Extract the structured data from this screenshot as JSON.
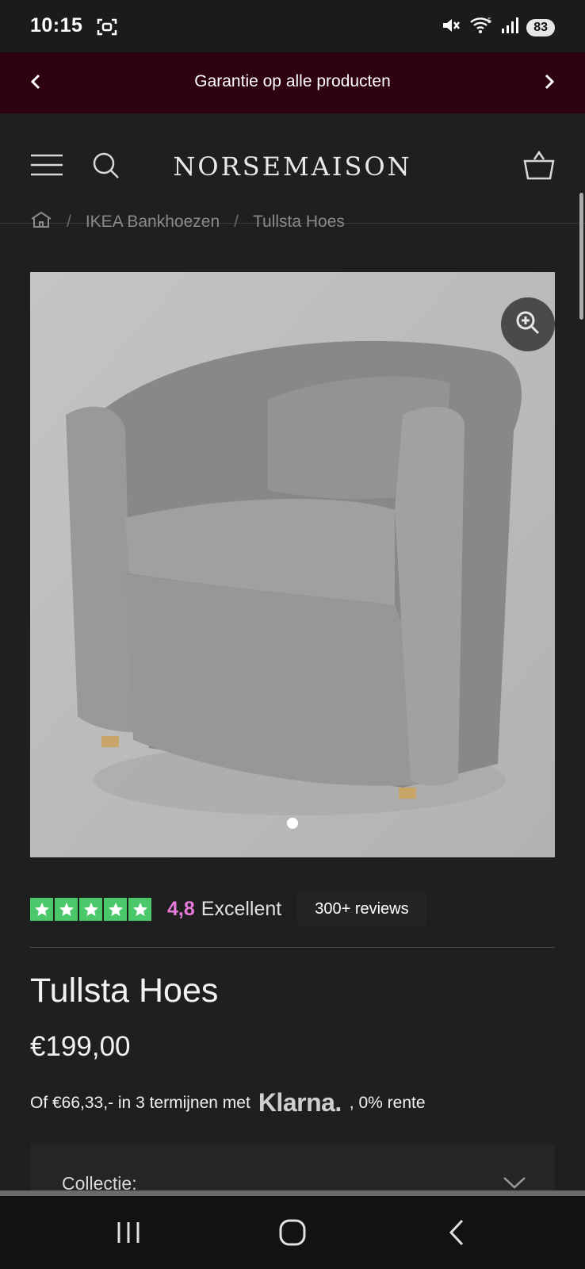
{
  "status_bar": {
    "time": "10:15",
    "battery": "83"
  },
  "announcement": {
    "text": "Garantie op alle producten"
  },
  "header": {
    "logo": "NORSEMAISON"
  },
  "breadcrumb": {
    "items": [
      "IKEA Bankhoezen",
      "Tullsta Hoes"
    ]
  },
  "rating": {
    "score": "4,8",
    "label": "Excellent",
    "reviews": "300+ reviews",
    "stars": 5,
    "star_color": "#4bc96a"
  },
  "product": {
    "title": "Tullsta Hoes",
    "price": "€199,00",
    "klarna": {
      "prefix": "Of €66,33,- in 3 termijnen met",
      "logo": "Klarna.",
      "suffix": ", 0% rente"
    }
  },
  "options": {
    "collectie_label": "Collectie:"
  },
  "colors": {
    "announcement_bg": "#2e0210",
    "accent_score": "#e67ad8"
  },
  "icons": [
    "scan-icon",
    "mute-icon",
    "wifi-icon",
    "signal-icon",
    "chevron-left-icon",
    "chevron-right-icon",
    "hamburger-menu-icon",
    "search-icon",
    "basket-icon",
    "home-icon",
    "zoom-in-icon",
    "star-icon",
    "chevron-down-icon",
    "recent-apps-icon",
    "home-button-icon",
    "back-icon"
  ]
}
